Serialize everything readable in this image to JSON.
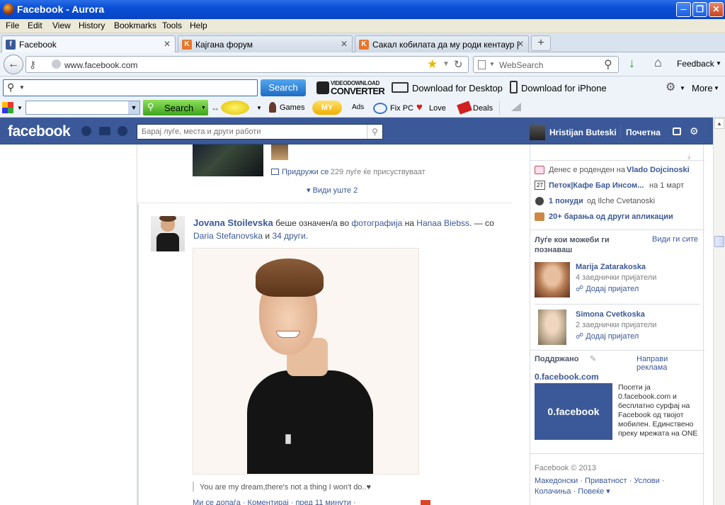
{
  "window": {
    "title": "Facebook - Aurora"
  },
  "menu": [
    "File",
    "Edit",
    "View",
    "History",
    "Bookmarks",
    "Tools",
    "Help"
  ],
  "tabs": [
    {
      "label": "Facebook",
      "icon": "f"
    },
    {
      "label": "Кајгана форум",
      "icon": "K"
    },
    {
      "label": "Сакал кобилата да му роди кентаур | ...",
      "icon": "K"
    }
  ],
  "nav": {
    "url": "www.facebook.com",
    "websearch_placeholder": "WebSearch",
    "feedback": "Feedback"
  },
  "toolbar1": {
    "search_btn": "Search",
    "vdc_line1": "VIDEODOWNLOAD",
    "vdc_line2": "CONVERTER",
    "download_desktop": "Download for Desktop",
    "download_iphone": "Download for iPhone",
    "more": "More"
  },
  "toolbar2": {
    "search_btn": "Search",
    "games": "Games",
    "my": "MY",
    "ads": "Ads",
    "fixpc": "Fix PC",
    "love": "Love",
    "deals": "Deals"
  },
  "fb": {
    "logo": "facebook",
    "search_placeholder": "Барај луѓе, места и други работи",
    "user": "Hristijan Buteski",
    "home": "Почетна"
  },
  "feed": {
    "event_join": "Придружи се",
    "event_count": " · 229 луѓе ќе присуствуваат",
    "see_more": "Види уште 2",
    "post_author": "Jovana Stoilevska",
    "post_text1": " беше означен/а во ",
    "post_photo": "фотографија",
    "post_text2": " на ",
    "post_owner": "Hanaa Biebss",
    "post_text3": ". — со ",
    "post_with": "Daria Stefanovska",
    "post_and": " и ",
    "post_others": "34 други",
    "post_end": ".",
    "caption": "You are my dream,there's not a thing I won't do..♥",
    "actions": "Ми се допаѓа · Коментирај · пред 11 минути ·"
  },
  "right": {
    "bday_prefix": "Денес е роденден на ",
    "bday_name": "Vlado Dojcinoski",
    "event_date": "27",
    "event_name": "Петок|Кафе Бар Инсом...",
    "event_when": " на 1 март",
    "offer_bold": "1 понуди",
    "offer_from": " од Ilche Cvetanoski",
    "app_requests": "20+ барања од други апликации",
    "pymk_title": "Луѓе кои можеби ги познаваш",
    "pymk_see_all": "Види ги сите",
    "people": [
      {
        "name": "Marija Zatarakoska",
        "mutual": "4 заеднички пријатели",
        "add": "Додај пријател"
      },
      {
        "name": "Simona Cvetkoska",
        "mutual": "2 заеднички пријатели",
        "add": "Додај пријател"
      }
    ],
    "sponsored": "Поддржано",
    "create_ad": "Направи реклама",
    "ad_title": "0.facebook.com",
    "ad_image_text": "0.facebook",
    "ad_text": "Посети ја 0.facebook.com и бесплатно сурфај на Facebook од твојот мобилен. Единствено преку мрежата на ONE",
    "footer_copy": "Facebook © 2013",
    "footer_links1": "Македонски · Приватност · Услови ·",
    "footer_links2": "Колачиња · Повеќе ▾"
  },
  "colors": {
    "fb_blue": "#3b5998",
    "link": "#3b5998",
    "title_blue": "#0a4fd6"
  }
}
